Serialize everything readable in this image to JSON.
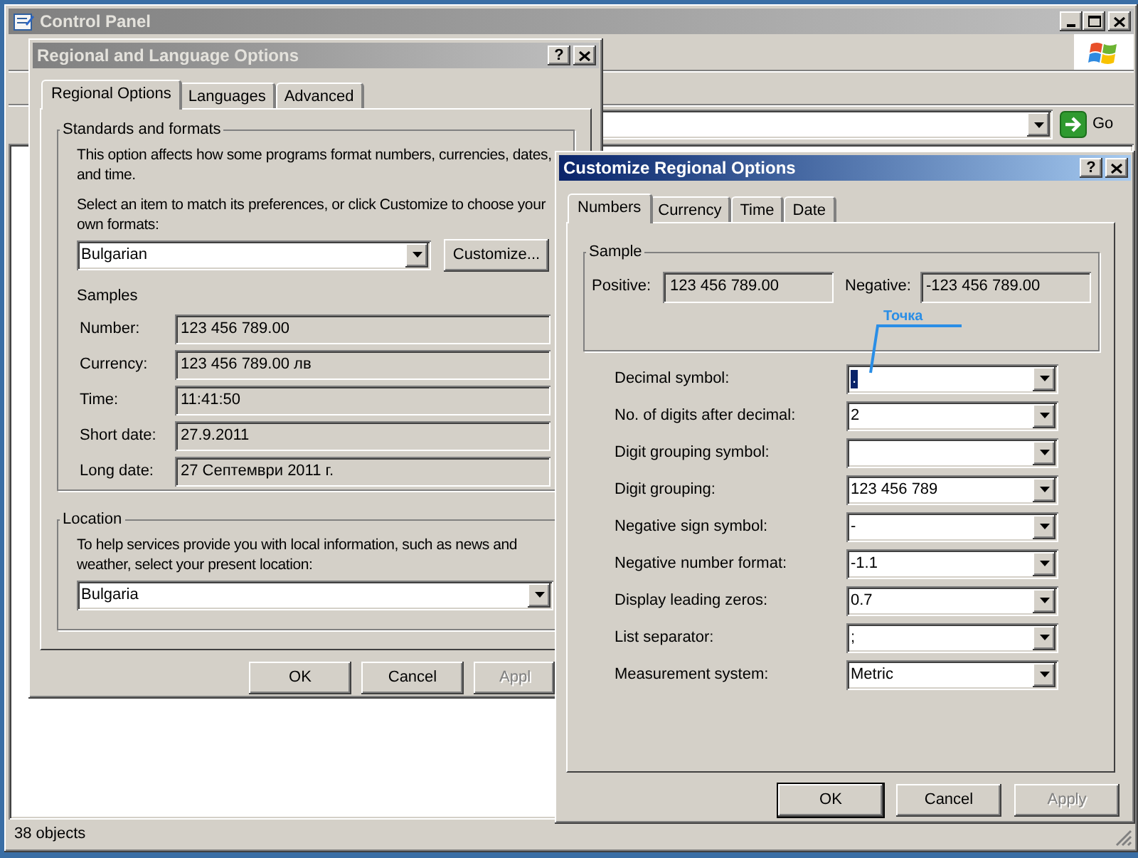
{
  "control_panel": {
    "title": "Control Panel",
    "active": false,
    "go_button": "Go",
    "status_bar": "38 objects"
  },
  "regional_dialog": {
    "title": "Regional and Language Options",
    "active": false,
    "help_button": "?",
    "tabs": [
      {
        "label": "Regional Options",
        "selected": true
      },
      {
        "label": "Languages",
        "selected": false
      },
      {
        "label": "Advanced",
        "selected": false
      }
    ],
    "standards": {
      "title": "Standards and formats",
      "description": "This option affects how some programs format numbers, currencies, dates, and time.",
      "prompt": "Select an item to match its preferences, or click Customize to choose your own formats:",
      "format": "Bulgarian",
      "customize_button": "Customize..."
    },
    "samples_title": "Samples",
    "samples": [
      {
        "label": "Number:",
        "value": "123 456 789.00"
      },
      {
        "label": "Currency:",
        "value": "123 456 789.00 лв"
      },
      {
        "label": "Time:",
        "value": "11:41:50"
      },
      {
        "label": "Short date:",
        "value": "27.9.2011"
      },
      {
        "label": "Long date:",
        "value": "27 Септември 2011 г."
      }
    ],
    "location": {
      "title": "Location",
      "description": "To help services provide you with local information, such as news and weather, select your present location:",
      "value": "Bulgaria"
    },
    "buttons": [
      {
        "label": "OK",
        "default": false,
        "disabled": false
      },
      {
        "label": "Cancel",
        "default": false,
        "disabled": false
      },
      {
        "label": "Appl",
        "default": false,
        "disabled": true
      }
    ]
  },
  "customize_dialog": {
    "title": "Customize Regional Options",
    "active": true,
    "help_button": "?",
    "tabs": [
      {
        "label": "Numbers",
        "selected": true
      },
      {
        "label": "Currency",
        "selected": false
      },
      {
        "label": "Time",
        "selected": false
      },
      {
        "label": "Date",
        "selected": false
      }
    ],
    "sample": {
      "title": "Sample",
      "positive_label": "Positive:",
      "positive_value": "123 456 789.00",
      "negative_label": "Negative:",
      "negative_value": "-123 456 789.00"
    },
    "annotation": "Точка",
    "settings": [
      {
        "label": "Decimal symbol:",
        "value": ".",
        "highlighted": true
      },
      {
        "label": "No. of digits after decimal:",
        "value": "2",
        "highlighted": false
      },
      {
        "label": "Digit grouping symbol:",
        "highlighted": false
      },
      {
        "label": "Digit grouping:",
        "value": "123 456 789",
        "highlighted": false
      },
      {
        "label": "Negative sign symbol:",
        "value": "-",
        "highlighted": false
      },
      {
        "label": "Negative number format:",
        "value": "-1.1",
        "highlighted": false
      },
      {
        "label": "Display leading zeros:",
        "value": "0.7",
        "highlighted": false
      },
      {
        "label": "List separator:",
        "value": ";",
        "highlighted": false
      },
      {
        "label": "Measurement system:",
        "value": "Metric",
        "highlighted": false
      }
    ],
    "buttons": [
      {
        "label": "OK",
        "default": true,
        "disabled": false
      },
      {
        "label": "Cancel",
        "default": false,
        "disabled": false
      },
      {
        "label": "Apply",
        "default": false,
        "disabled": true
      }
    ]
  }
}
